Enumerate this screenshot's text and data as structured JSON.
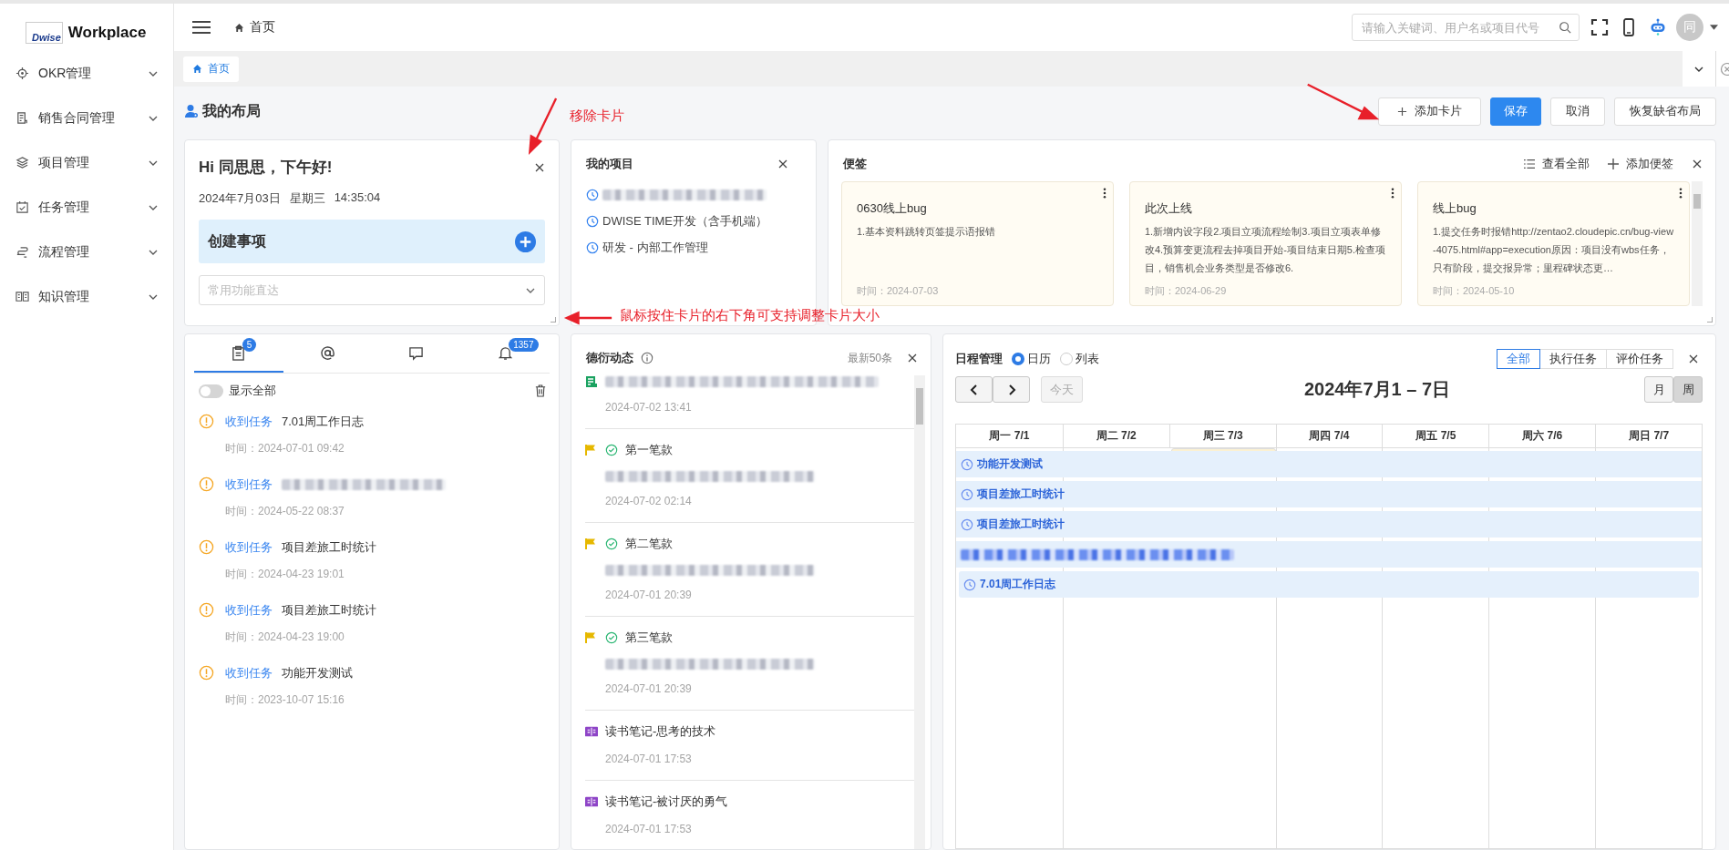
{
  "brand": {
    "logo_text": "Dwise",
    "name": "Workplace"
  },
  "sidebar": {
    "items": [
      {
        "label": "OKR管理"
      },
      {
        "label": "销售合同管理"
      },
      {
        "label": "项目管理"
      },
      {
        "label": "任务管理"
      },
      {
        "label": "流程管理"
      },
      {
        "label": "知识管理"
      }
    ]
  },
  "header": {
    "breadcrumb": "首页",
    "search": {
      "placeholder": "请输入关键词、用户名或项目代号"
    },
    "avatar": "同"
  },
  "page_tabs": [
    {
      "label": "首页",
      "selected": true
    }
  ],
  "layout": {
    "title": "我的布局",
    "buttons": [
      {
        "label": "添加卡片",
        "kind": "add"
      },
      {
        "label": "保存",
        "kind": "primary"
      },
      {
        "label": "取消",
        "kind": "plain"
      },
      {
        "label": "恢复缺省布局",
        "kind": "plain"
      }
    ]
  },
  "greeting": {
    "title": "Hi 同思思，下午好!",
    "date": "2024年7月03日",
    "weekday": "星期三",
    "time": "14:35:04",
    "create_label": "创建事项",
    "quick_select": {
      "placeholder": "常用功能直达"
    }
  },
  "projects": {
    "title": "我的项目",
    "items": [
      {
        "redacted": true
      },
      {
        "name": "DWISE TIME开发（含手机端）",
        "redacted": false
      },
      {
        "name": "研发 - 内部工作管理",
        "redacted": false
      }
    ]
  },
  "notes": {
    "title": "便签",
    "actions": [
      "查看全部",
      "添加便签"
    ],
    "items": [
      {
        "title": "0630线上bug",
        "body": "1.基本资料跳转页签提示语报错",
        "time": "时间：2024-07-03"
      },
      {
        "title": "此次上线",
        "body": "1.新增内设字段2.项目立项流程绘制3.项目立项表单修改4.预算变更流程去掉项目开始-项目结束日期5.检查项目，销售机会业务类型是否修改6.",
        "time": "时间：2024-06-29"
      },
      {
        "title": "线上bug",
        "body": "1.提交任务时报错http://zentao2.cloudepic.cn/bug-view-4075.html#app=execution原因：项目没有wbs任务，只有阶段，提交报异常；里程碑状态更…",
        "time": "时间：2024-05-10"
      }
    ]
  },
  "messages": {
    "tabs": [
      {
        "selected": true,
        "badge": "5"
      },
      {
        "selected": false
      },
      {
        "selected": false
      },
      {
        "selected": false,
        "badge": "1357"
      }
    ],
    "toggle": {
      "label": "显示全部",
      "on": false
    },
    "items": [
      {
        "tag": "收到任务",
        "title": "7.01周工作日志",
        "redacted": false,
        "time": "时间：2024-07-01 09:42"
      },
      {
        "tag": "收到任务",
        "redacted": true,
        "time": "时间：2024-05-22 08:37"
      },
      {
        "tag": "收到任务",
        "title": "项目差旅工时统计",
        "redacted": false,
        "time": "时间：2024-04-23 19:01"
      },
      {
        "tag": "收到任务",
        "title": "项目差旅工时统计",
        "redacted": false,
        "time": "时间：2024-04-23 19:00"
      },
      {
        "tag": "收到任务",
        "title": "功能开发测试",
        "redacted": false,
        "time": "时间：2023-10-07 15:16"
      }
    ]
  },
  "activity": {
    "title": "德衍动态",
    "count": "最新50条",
    "items": [
      {
        "kind": "document",
        "time": "2024-07-02 13:41"
      },
      {
        "kind": "payment",
        "title": "第一笔款",
        "time": "2024-07-02 02:14"
      },
      {
        "kind": "payment",
        "title": "第二笔款",
        "time": "2024-07-01 20:39"
      },
      {
        "kind": "payment",
        "title": "第三笔款",
        "time": "2024-07-01 20:39"
      },
      {
        "kind": "note",
        "title": "读书笔记-思考的技术",
        "time": "2024-07-01 17:53"
      },
      {
        "kind": "note",
        "title": "读书笔记-被讨厌的勇气",
        "time": "2024-07-01 17:53"
      }
    ]
  },
  "schedule": {
    "title": "日程管理",
    "modes": [
      {
        "label": "日历",
        "selected": true
      },
      {
        "label": "列表",
        "selected": false
      }
    ],
    "filters": [
      {
        "label": "全部",
        "selected": true
      },
      {
        "label": "执行任务",
        "selected": false
      },
      {
        "label": "评价任务",
        "selected": false
      }
    ],
    "today_button": {
      "label": "今天",
      "disabled": true
    },
    "range": "2024年7月1 – 7日",
    "views": [
      {
        "label": "月",
        "selected": false
      },
      {
        "label": "周",
        "selected": true
      }
    ],
    "days": [
      {
        "label": "周一 7/1",
        "today": false
      },
      {
        "label": "周二 7/2",
        "today": false
      },
      {
        "label": "周三 7/3",
        "today": true
      },
      {
        "label": "周四 7/4",
        "today": false
      },
      {
        "label": "周五 7/5",
        "today": false
      },
      {
        "label": "周六 7/6",
        "today": false
      },
      {
        "label": "周日 7/7",
        "today": false
      }
    ],
    "events": [
      {
        "title": "功能开发测试",
        "redacted": false
      },
      {
        "title": "项目差旅工时统计",
        "redacted": false
      },
      {
        "title": "项目差旅工时统计",
        "redacted": false
      },
      {
        "redacted": true
      },
      {
        "title": "7.01周工作日志",
        "redacted": false
      }
    ]
  },
  "annotations": [
    {
      "kind": "callout",
      "text": "移除卡片"
    },
    {
      "kind": "callout",
      "text": "鼠标按住卡片的右下角可支持调整卡片大小"
    },
    {
      "kind": "arrow"
    }
  ]
}
